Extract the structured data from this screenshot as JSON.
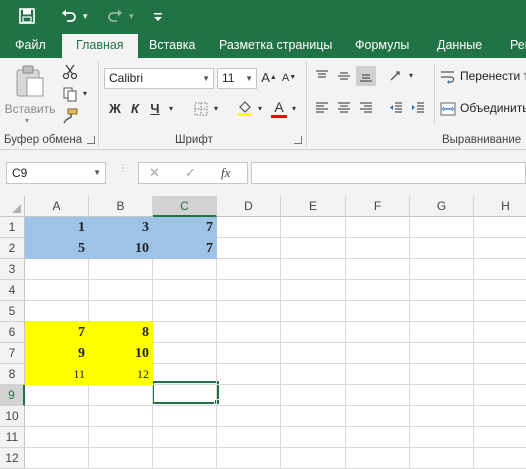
{
  "quick_access": {
    "save_icon": "save-icon",
    "undo_icon": "undo-icon",
    "redo_icon": "redo-icon",
    "customize_icon": "customize-icon"
  },
  "tabs": [
    {
      "label": "Файл"
    },
    {
      "label": "Главная"
    },
    {
      "label": "Вставка"
    },
    {
      "label": "Разметка страницы"
    },
    {
      "label": "Формулы"
    },
    {
      "label": "Данные"
    },
    {
      "label": "Рец"
    }
  ],
  "ribbon": {
    "clipboard": {
      "paste_label": "Вставить",
      "group_label": "Буфер обмена"
    },
    "font": {
      "font_name": "Calibri",
      "font_size": "11",
      "bold": "Ж",
      "italic": "К",
      "underline": "Ч",
      "font_color": "A",
      "font_color_value": "#ff0000",
      "fill_color_value": "#ffff00",
      "group_label": "Шрифт"
    },
    "alignment": {
      "wrap_text": "Перенести т",
      "merge": "Объединить",
      "group_label": "Выравнивание"
    }
  },
  "formula_bar": {
    "name_box": "C9",
    "cancel": "✕",
    "enter": "✓",
    "fx": "fx",
    "value": ""
  },
  "sheet": {
    "columns": [
      "A",
      "B",
      "C",
      "D",
      "E",
      "F",
      "G",
      "H"
    ],
    "selected_column": "C",
    "selected_row": "9",
    "rows": [
      {
        "n": "1",
        "cells": {
          "A": "1",
          "B": "3",
          "C": "7"
        }
      },
      {
        "n": "2",
        "cells": {
          "A": "5",
          "B": "10",
          "C": "7"
        }
      },
      {
        "n": "3",
        "cells": {}
      },
      {
        "n": "4",
        "cells": {}
      },
      {
        "n": "5",
        "cells": {}
      },
      {
        "n": "6",
        "cells": {
          "A": "7",
          "B": "8"
        }
      },
      {
        "n": "7",
        "cells": {
          "A": "9",
          "B": "10"
        }
      },
      {
        "n": "8",
        "cells": {
          "A": "11",
          "B": "12"
        }
      },
      {
        "n": "9",
        "cells": {}
      },
      {
        "n": "10",
        "cells": {}
      },
      {
        "n": "11",
        "cells": {}
      },
      {
        "n": "12",
        "cells": {}
      }
    ],
    "fills": {
      "blue": "#9dc3e6",
      "yellow": "#ffff00"
    }
  }
}
